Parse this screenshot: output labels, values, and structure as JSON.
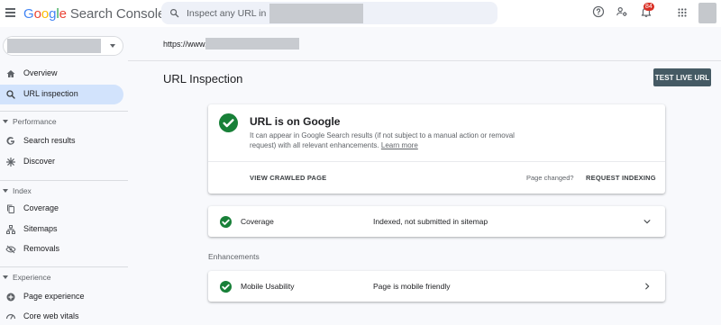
{
  "header": {
    "logo_google": [
      "G",
      "o",
      "o",
      "g",
      "l",
      "e"
    ],
    "logo_product": "Search Console",
    "search_placeholder": "Inspect any URL in",
    "notification_count": "84"
  },
  "sidebar": {
    "items": [
      {
        "label": "Overview",
        "icon": "home-icon"
      },
      {
        "label": "URL inspection",
        "icon": "search-icon",
        "active": true
      }
    ],
    "sections": [
      {
        "title": "Performance",
        "items": [
          {
            "label": "Search results",
            "icon": "google-g-icon"
          },
          {
            "label": "Discover",
            "icon": "asterisk-icon"
          }
        ]
      },
      {
        "title": "Index",
        "items": [
          {
            "label": "Coverage",
            "icon": "copy-icon"
          },
          {
            "label": "Sitemaps",
            "icon": "sitemap-icon"
          },
          {
            "label": "Removals",
            "icon": "eye-off-icon"
          }
        ]
      },
      {
        "title": "Experience",
        "items": [
          {
            "label": "Page experience",
            "icon": "plus-circle-icon"
          },
          {
            "label": "Core web vitals",
            "icon": "gauge-icon"
          }
        ]
      }
    ]
  },
  "main": {
    "url_prefix": "https://www.",
    "title": "URL Inspection",
    "test_live_url": "TEST LIVE URL",
    "status_card": {
      "title": "URL is on Google",
      "description": "It can appear in Google Search results (if not subject to a manual action or removal request) with all relevant enhancements.",
      "learn_more": "Learn more",
      "view_crawled": "VIEW CRAWLED PAGE",
      "page_changed": "Page changed?",
      "request_indexing": "REQUEST INDEXING"
    },
    "coverage": {
      "label": "Coverage",
      "value": "Indexed, not submitted in sitemap"
    },
    "enhancements_label": "Enhancements",
    "mobile": {
      "label": "Mobile Usability",
      "value": "Page is mobile friendly"
    }
  },
  "colors": {
    "success": "#188038",
    "active_nav": "#d2e3fc",
    "test_button": "#455a64",
    "badge": "#d93025"
  }
}
